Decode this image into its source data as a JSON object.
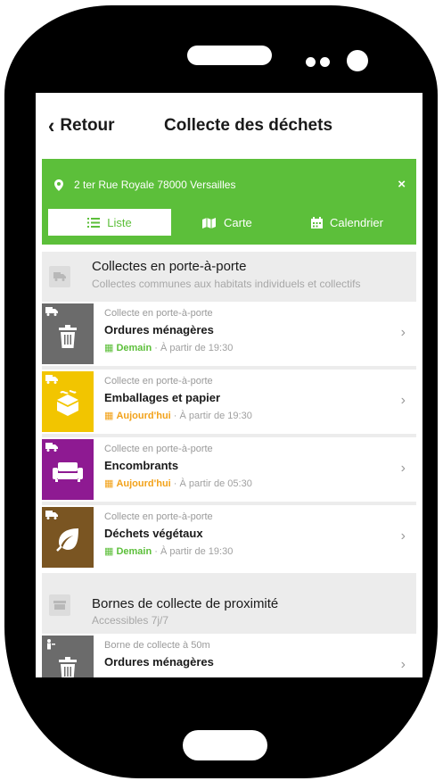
{
  "header": {
    "back_label": "Retour",
    "title": "Collecte des déchets"
  },
  "address": {
    "text": "2 ter Rue Royale 78000 Versailles",
    "close": "×"
  },
  "tabs": [
    {
      "label": "Liste"
    },
    {
      "label": "Carte"
    },
    {
      "label": "Calendrier"
    }
  ],
  "section_door": {
    "title": "Collectes en porte-à-porte",
    "subtitle": "Collectes communes aux habitats individuels et collectifs"
  },
  "items": [
    {
      "category": "Collecte en porte-à-porte",
      "name": "Ordures ménagères",
      "day": "Demain",
      "time": " · À partir de 19:30",
      "color": "#6b6b6b",
      "day_color": "#5cbf3a",
      "icon": "trash-can-icon"
    },
    {
      "category": "Collecte en porte-à-porte",
      "name": "Emballages et papier",
      "day": "Aujourd'hui",
      "time": " · À partir de 19:30",
      "color": "#f2c500",
      "day_color": "#f2a21a",
      "icon": "packaging-icon"
    },
    {
      "category": "Collecte en porte-à-porte",
      "name": "Encombrants",
      "day": "Aujourd'hui",
      "time": " · À partir de 05:30",
      "color": "#8e1a92",
      "day_color": "#f2a21a",
      "icon": "sofa-icon"
    },
    {
      "category": "Collecte en porte-à-porte",
      "name": "Déchets végétaux",
      "day": "Demain",
      "time": " · À partir de 19:30",
      "color": "#7a5522",
      "day_color": "#5cbf3a",
      "icon": "leaf-icon"
    }
  ],
  "section_bornes": {
    "title": "Bornes de collecte de proximité",
    "subtitle": "Accessibles 7j/7"
  },
  "bornes": [
    {
      "category": "Borne de collecte à 50m",
      "name": "Ordures ménagères",
      "color": "#6b6b6b",
      "icon": "trash-can-icon"
    }
  ],
  "colors": {
    "accent": "#5cbf3a",
    "section_bg": "#ececec"
  }
}
